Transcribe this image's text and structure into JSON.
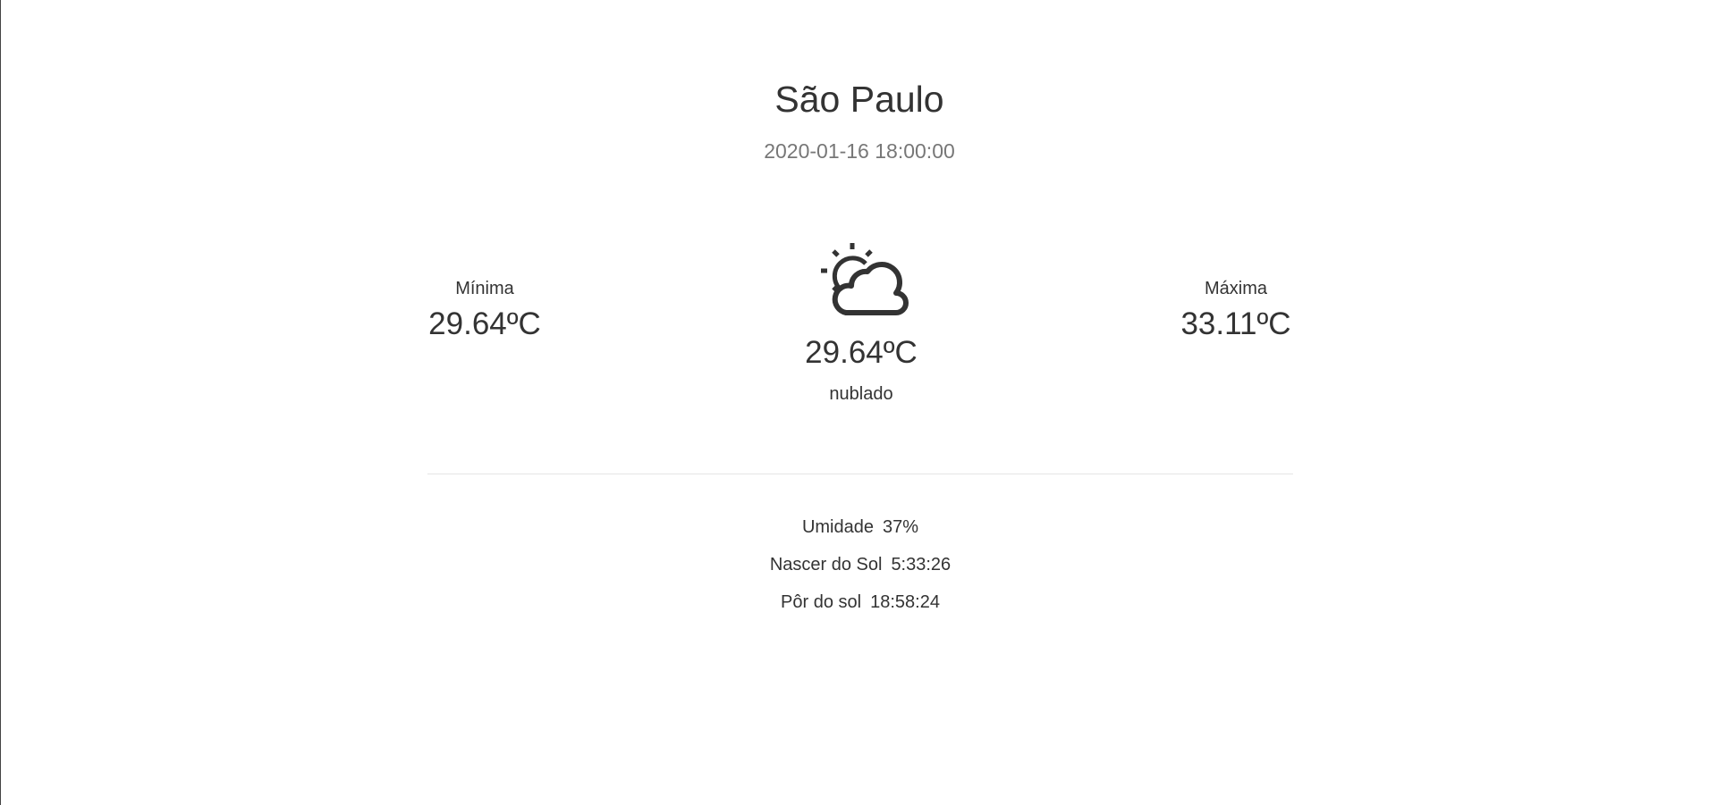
{
  "location": {
    "city": "São Paulo",
    "datetime": "2020-01-16 18:00:00"
  },
  "temperatures": {
    "min_label": "Mínima",
    "min_value": "29.64ºC",
    "max_label": "Máxima",
    "max_value": "33.11ºC",
    "current_value": "29.64ºC",
    "condition": "nublado"
  },
  "icon": "partly-cloudy-icon",
  "details": [
    {
      "label": "Umidade",
      "value": "37%"
    },
    {
      "label": "Nascer do Sol",
      "value": "5:33:26"
    },
    {
      "label": "Pôr do sol",
      "value": "18:58:24"
    }
  ],
  "colors": {
    "text": "#333333",
    "muted": "#777777",
    "divider": "#e5e5e5",
    "background": "#ffffff"
  }
}
